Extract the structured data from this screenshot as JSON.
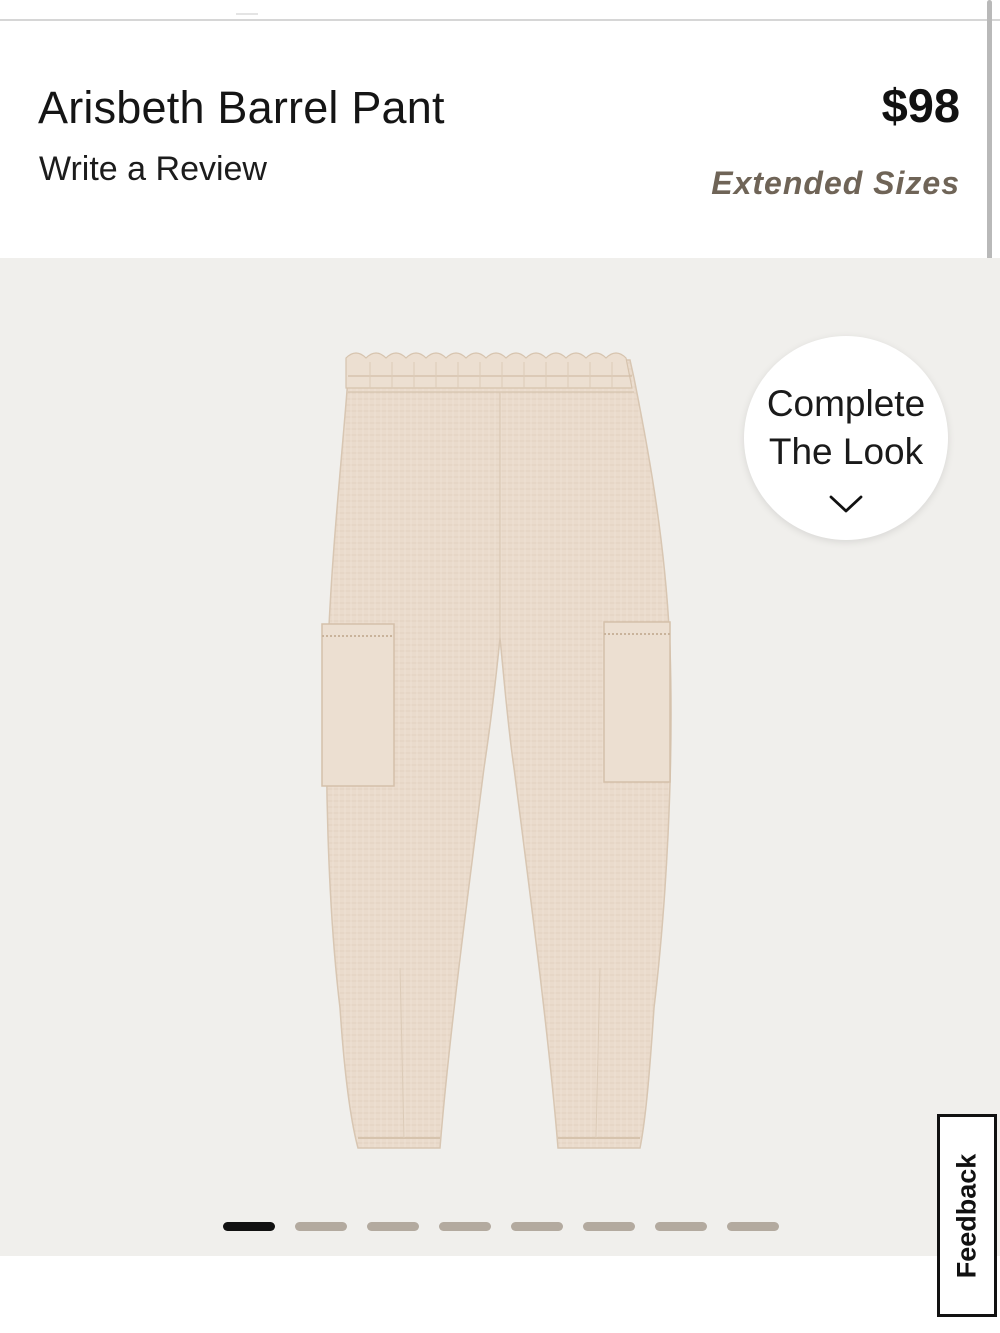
{
  "product": {
    "title": "Arisbeth Barrel Pant",
    "write_review_label": "Write a Review",
    "price": "$98",
    "extended_sizes_label": "Extended Sizes"
  },
  "gallery": {
    "background_color": "#f0efec",
    "product_color": "#eadbcc",
    "image_subject": "barrel pant with cargo pockets",
    "complete_the_look": {
      "line1": "Complete",
      "line2": "The Look",
      "icon": "chevron-down-icon"
    },
    "slide_count": 8,
    "active_slide_index": 0
  },
  "feedback": {
    "label": "Feedback"
  },
  "colors": {
    "accent_text": "#6f6457",
    "dot_inactive": "#b3aa9f",
    "dot_active": "#111111"
  }
}
